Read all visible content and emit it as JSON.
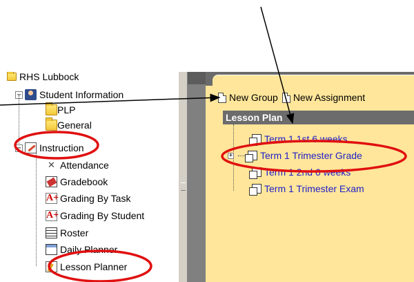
{
  "tree": {
    "root_label": "RHS Lubbock",
    "items": [
      {
        "label": "Student Information",
        "icon": "student-info-icon",
        "expander": "−"
      },
      {
        "label": "PLP",
        "icon": "folder-icon"
      },
      {
        "label": "General",
        "icon": "folder-icon"
      },
      {
        "label": "Instruction",
        "icon": "instruction-icon",
        "expander": "−"
      },
      {
        "label": "Attendance",
        "icon": "attendance-icon"
      },
      {
        "label": "Gradebook",
        "icon": "gradebook-icon"
      },
      {
        "label": "Grading By Task",
        "icon": "grading-task-icon",
        "glyph": "A+"
      },
      {
        "label": "Grading By Student",
        "icon": "grading-student-icon",
        "glyph": "A+"
      },
      {
        "label": "Roster",
        "icon": "roster-icon"
      },
      {
        "label": "Daily Planner",
        "icon": "daily-planner-icon"
      },
      {
        "label": "Lesson Planner",
        "icon": "lesson-planner-icon"
      }
    ]
  },
  "toolbar": {
    "new_group": "New Group",
    "new_assignment": "New Assignment"
  },
  "lesson_plan": {
    "header": "Lesson Plan",
    "items": [
      {
        "label": "Term 1 1st 6 weeks",
        "expander": ""
      },
      {
        "label": "Term 1 Trimester Grade",
        "expander": "+"
      },
      {
        "label": "Term 1 2nd 6 weeks",
        "expander": ""
      },
      {
        "label": "Term 1 Trimester Exam",
        "expander": ""
      }
    ]
  },
  "colors": {
    "annotation_red": "#e01010",
    "panel_yellow": "#ffe69a",
    "header_gray": "#6c6c6c",
    "link_blue": "#2020c8"
  }
}
